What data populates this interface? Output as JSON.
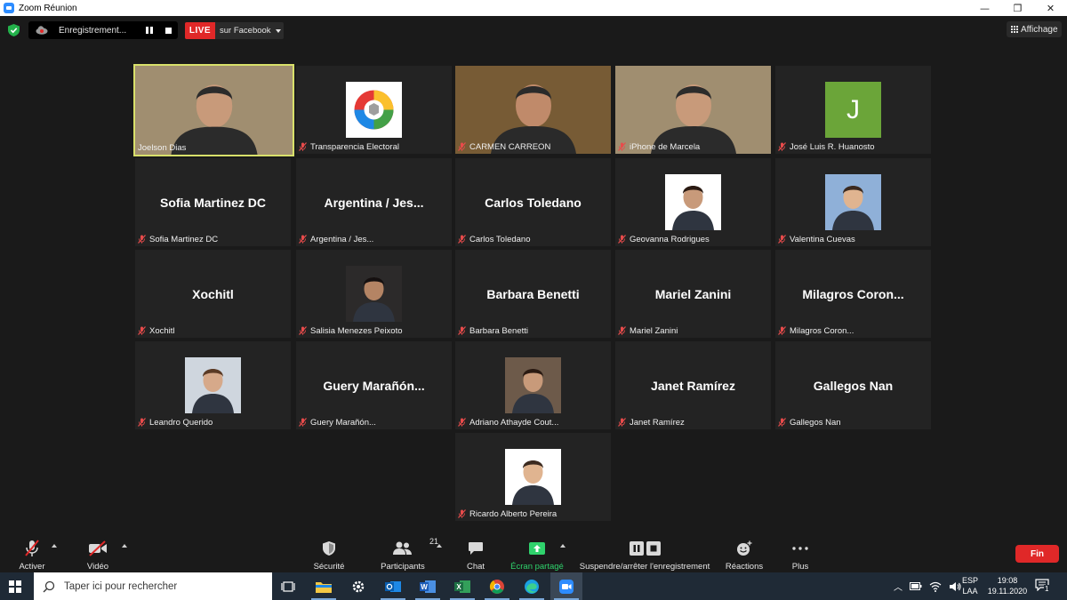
{
  "window": {
    "title": "Zoom Réunion",
    "minimize": "—",
    "maximize": "❐",
    "close": "✕"
  },
  "topbar": {
    "recording_text": "Enregistrement...",
    "live_badge": "LIVE",
    "live_target": "sur Facebook",
    "view_label": "Affichage"
  },
  "tiles": [
    {
      "name": "Joelson Dias",
      "kind": "video",
      "active": true,
      "muted": false
    },
    {
      "name": "Transparencia Electoral",
      "kind": "avatar",
      "avatar": "logo",
      "muted": true
    },
    {
      "name": "CARMEN CARREON",
      "kind": "video",
      "muted": true
    },
    {
      "name": "iPhone de Marcela",
      "kind": "video",
      "muted": true
    },
    {
      "name": "José Luis R. Huanosto",
      "kind": "avatar",
      "avatar": "letter",
      "letter": "J",
      "muted": true
    },
    {
      "name": "Sofia Martinez DC",
      "kind": "name",
      "muted": true
    },
    {
      "name": "Argentina / Jes...",
      "kind": "name",
      "muted": true
    },
    {
      "name": "Carlos Toledano",
      "kind": "name",
      "muted": true
    },
    {
      "name": "Geovanna Rodrigues",
      "kind": "avatar",
      "avatar": "photo",
      "muted": true
    },
    {
      "name": "Valentina Cuevas",
      "kind": "avatar",
      "avatar": "photo",
      "muted": true
    },
    {
      "name": "Xochitl",
      "kind": "name",
      "muted": true
    },
    {
      "name": "Salisia Menezes Peixoto",
      "kind": "avatar",
      "avatar": "photo",
      "muted": true
    },
    {
      "name": "Barbara Benetti",
      "kind": "name",
      "muted": true
    },
    {
      "name": "Mariel Zanini",
      "kind": "name",
      "muted": true
    },
    {
      "name": "Milagros Coron...",
      "kind": "name",
      "muted": true
    },
    {
      "name": "Leandro Querido",
      "kind": "avatar",
      "avatar": "photo",
      "muted": true
    },
    {
      "name": "Guery Marañón...",
      "kind": "name",
      "muted": true
    },
    {
      "name": "Adriano Athayde Cout...",
      "kind": "avatar",
      "avatar": "photo",
      "muted": true
    },
    {
      "name": "Janet Ramírez",
      "kind": "name",
      "muted": true
    },
    {
      "name": "Gallegos Nan",
      "kind": "name",
      "muted": true
    },
    {
      "name": "Ricardo Alberto Pereira",
      "kind": "avatar",
      "avatar": "photo",
      "muted": true
    }
  ],
  "toolbar": {
    "unmute": "Activer",
    "video": "Vidéo",
    "security": "Sécurité",
    "participants": "Participants",
    "participants_count": "21",
    "chat": "Chat",
    "share": "Écran partagé",
    "recording": "Suspendre/arrêter l'enregistrement",
    "reactions": "Réactions",
    "more": "Plus",
    "end": "Fin"
  },
  "taskbar": {
    "search_placeholder": "Taper ici pour rechercher",
    "lang_top": "ESP",
    "lang_bottom": "LAA",
    "time": "19:08",
    "date": "19.11.2020",
    "notifications": "1"
  },
  "colors": {
    "active_speaker_border": "#d8e06a",
    "live_red": "#e02828",
    "share_green": "#2fd26c",
    "avatar_green": "#6ba539",
    "taskbar": "#1f2a36"
  }
}
